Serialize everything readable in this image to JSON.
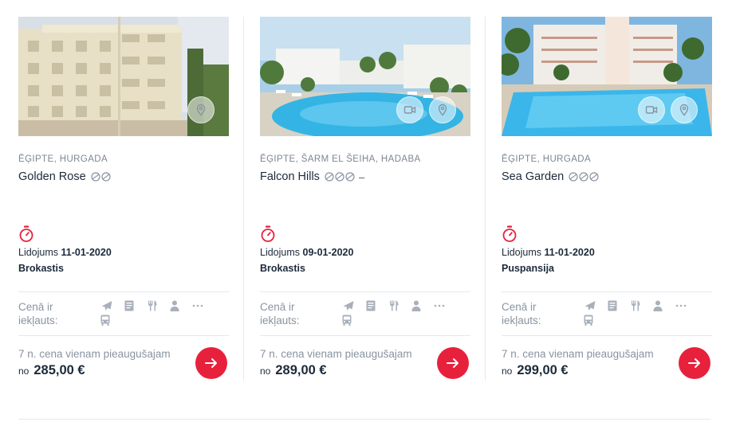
{
  "colors": {
    "accent": "#e7213c",
    "text_dark": "#1c2a3a",
    "text_muted": "#8a93a1",
    "icon_muted": "#a9b0bb",
    "divider": "#e6e8ec"
  },
  "cards": [
    {
      "location": "ĒĢIPTE, HURGADA",
      "hotel_name": "Golden Rose",
      "rating_icons": 2,
      "rating_suffix": "",
      "has_video": false,
      "flight_label": "Lidojums",
      "flight_date": "11-01-2020",
      "board": "Brokastis",
      "included_label": "Cenā ir iekļauts:",
      "included_icons": [
        "plane-icon",
        "document-icon",
        "fork-knife-icon",
        "person-icon",
        "more-icon",
        "bus-icon"
      ],
      "price_note": "7 n. cena vienam pieaugušajam",
      "price_prefix": "no",
      "price": "285,00 €"
    },
    {
      "location": "ĒĢIPTE, ŠARM EL ŠEIHA, HADABA",
      "hotel_name": "Falcon Hills",
      "rating_icons": 3,
      "rating_suffix": "–",
      "has_video": true,
      "flight_label": "Lidojums",
      "flight_date": "09-01-2020",
      "board": "Brokastis",
      "included_label": "Cenā ir iekļauts:",
      "included_icons": [
        "plane-icon",
        "document-icon",
        "fork-knife-icon",
        "person-icon",
        "more-icon",
        "bus-icon"
      ],
      "price_note": "7 n. cena vienam pieaugušajam",
      "price_prefix": "no",
      "price": "289,00 €"
    },
    {
      "location": "ĒĢIPTE, HURGADA",
      "hotel_name": "Sea Garden",
      "rating_icons": 3,
      "rating_suffix": "",
      "has_video": true,
      "flight_label": "Lidojums",
      "flight_date": "11-01-2020",
      "board": "Puspansija",
      "included_label": "Cenā ir iekļauts:",
      "included_icons": [
        "plane-icon",
        "document-icon",
        "fork-knife-icon",
        "person-icon",
        "more-icon",
        "bus-icon"
      ],
      "price_note": "7 n. cena vienam pieaugušajam",
      "price_prefix": "no",
      "price": "299,00 €"
    }
  ]
}
